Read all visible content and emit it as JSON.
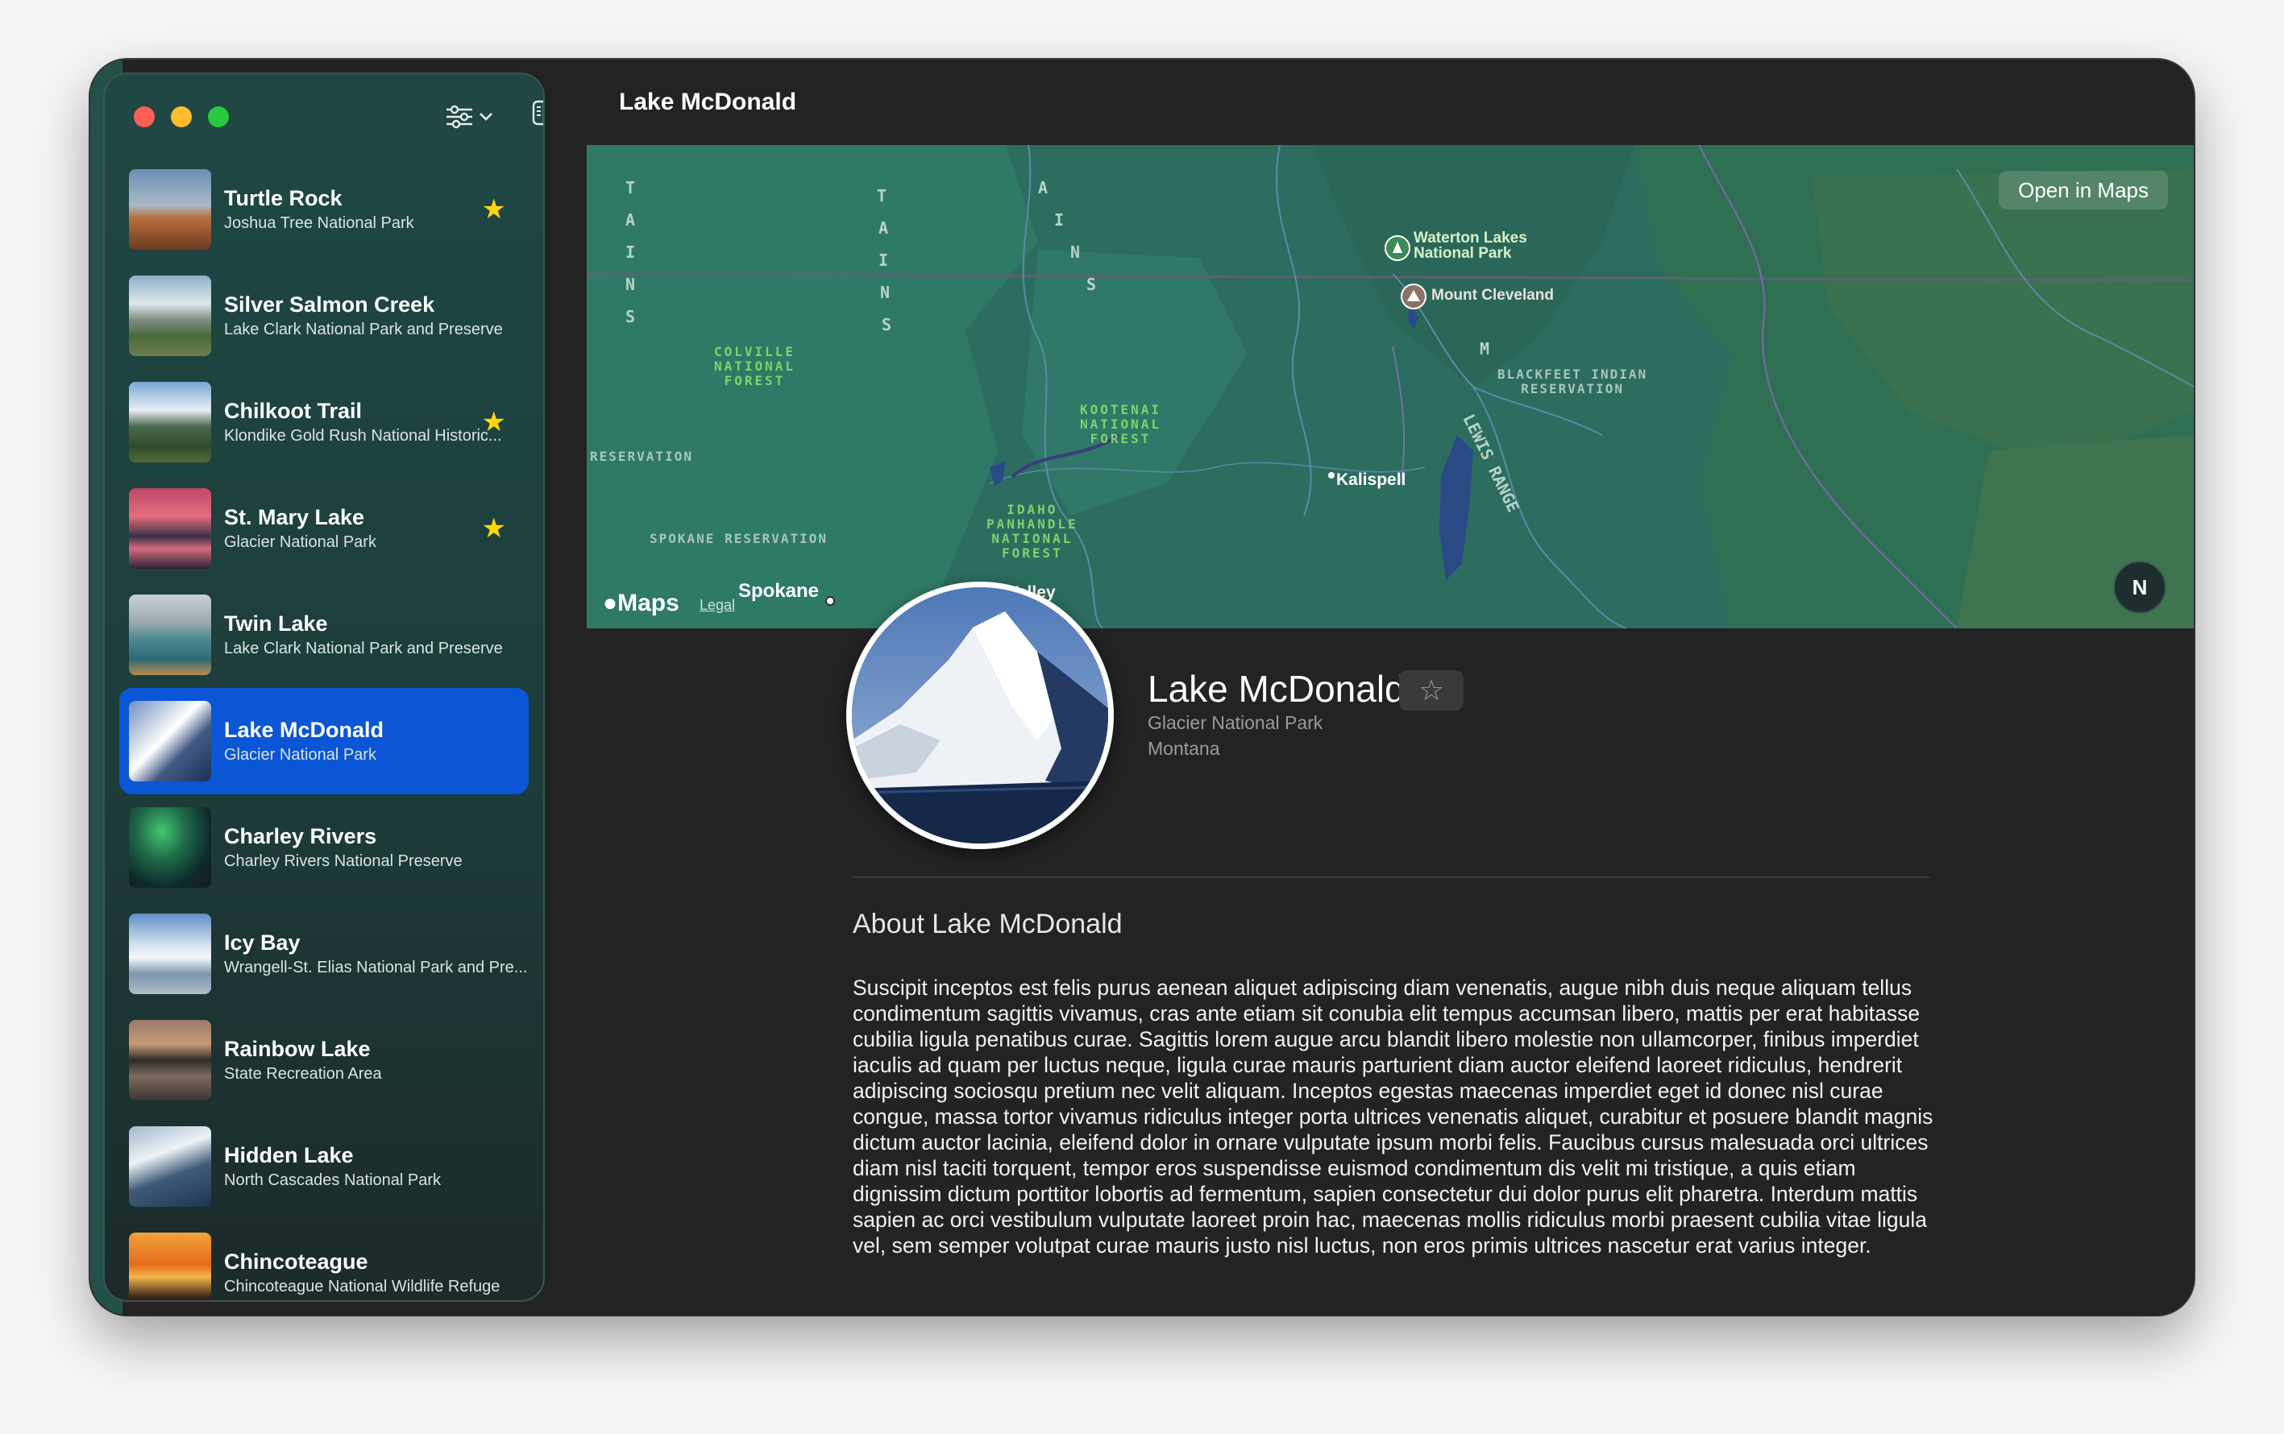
{
  "window": {
    "title": "Lake McDonald"
  },
  "sidebar": {
    "items": [
      {
        "title": "Turtle Rock",
        "subtitle": "Joshua Tree National Park",
        "favorite": true,
        "selected": false
      },
      {
        "title": "Silver Salmon Creek",
        "subtitle": "Lake Clark National Park and Preserve",
        "favorite": false,
        "selected": false
      },
      {
        "title": "Chilkoot Trail",
        "subtitle": "Klondike Gold Rush National Historic...",
        "favorite": true,
        "selected": false
      },
      {
        "title": "St. Mary Lake",
        "subtitle": "Glacier National Park",
        "favorite": true,
        "selected": false
      },
      {
        "title": "Twin Lake",
        "subtitle": "Lake Clark National Park and Preserve",
        "favorite": false,
        "selected": false
      },
      {
        "title": "Lake McDonald",
        "subtitle": "Glacier National Park",
        "favorite": false,
        "selected": true
      },
      {
        "title": "Charley Rivers",
        "subtitle": "Charley Rivers National Preserve",
        "favorite": false,
        "selected": false
      },
      {
        "title": "Icy Bay",
        "subtitle": "Wrangell-St. Elias National Park and Pre...",
        "favorite": false,
        "selected": false
      },
      {
        "title": "Rainbow Lake",
        "subtitle": "State Recreation Area",
        "favorite": false,
        "selected": false
      },
      {
        "title": "Hidden Lake",
        "subtitle": "North Cascades National Park",
        "favorite": false,
        "selected": false
      },
      {
        "title": "Chincoteague",
        "subtitle": "Chincoteague National Wildlife Refuge",
        "favorite": false,
        "selected": false
      }
    ],
    "star_glyph": "★"
  },
  "map": {
    "open_button": "Open in Maps",
    "logo": "Maps",
    "legal": "Legal",
    "compass": "N",
    "labels": {
      "colville": "COLVILLE\nNATIONAL\nFOREST",
      "kootenai": "KOOTENAI\nNATIONAL\nFOREST",
      "idaho": "IDAHO\nPANHANDLE\nNATIONAL\nFOREST",
      "blackfeet": "BLACKFEET INDIAN\nRESERVATION",
      "reservation": "RESERVATION",
      "spokane_reservation": "SPOKANE RESERVATION",
      "waterton": "Waterton Lakes\nNational Park",
      "mount_cleveland": "Mount Cleveland",
      "kalispell": "Kalispell",
      "spokane": "Spokane",
      "spokane_valley": "Valley",
      "lewis_range": "LEWIS RANGE"
    }
  },
  "detail": {
    "name": "Lake McDonald",
    "favorite_glyph": "☆",
    "park": "Glacier National Park",
    "state": "Montana",
    "about_title": "About Lake McDonald",
    "about_body": "Suscipit inceptos est felis purus aenean aliquet adipiscing diam venenatis, augue nibh duis neque aliquam tellus condimentum sagittis vivamus, cras ante etiam sit conubia elit tempus accumsan libero, mattis per erat habitasse cubilia ligula penatibus curae. Sagittis lorem augue arcu blandit libero molestie non ullamcorper, finibus imperdiet iaculis ad quam per luctus neque, ligula curae mauris parturient diam auctor eleifend laoreet ridiculus, hendrerit adipiscing sociosqu pretium nec velit aliquam. Inceptos egestas maecenas imperdiet eget id donec nisl curae congue, massa tortor vivamus ridiculus integer porta ultrices venenatis aliquet, curabitur et posuere blandit magnis dictum auctor lacinia, eleifend dolor in ornare vulputate ipsum morbi felis. Faucibus cursus malesuada orci ultrices diam nisl taciti torquent, tempor eros suspendisse euismod condimentum dis velit mi tristique, a quis etiam dignissim dictum porttitor lobortis ad fermentum, sapien consectetur dui dolor purus elit pharetra. Interdum mattis sapien ac orci vestibulum vulputate laoreet proin hac, maecenas mollis ridiculus morbi praesent cubilia vitae ligula vel, sem semper volutpat curae mauris justo nisl luctus, non eros primis ultrices nascetur erat varius integer."
  },
  "colors": {
    "accent": "#0a56d6",
    "star": "#ffd60a",
    "window_bg": "#232324",
    "traffic_close": "#fe5f57",
    "traffic_minimize": "#febc2e",
    "traffic_zoom": "#28c840"
  }
}
